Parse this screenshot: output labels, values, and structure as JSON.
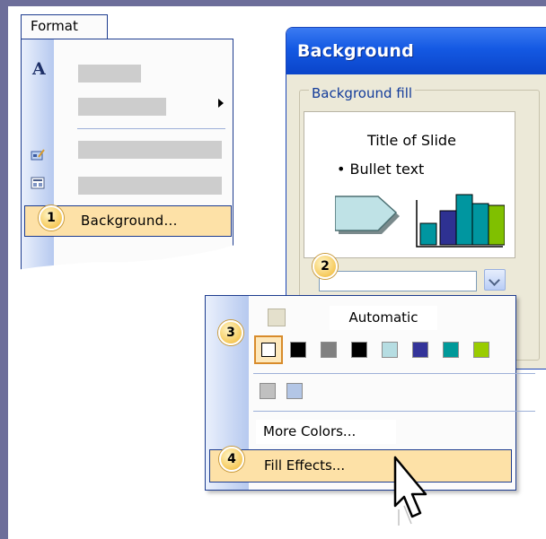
{
  "format_menu": {
    "tab_label": "Format",
    "background_item": {
      "number": "1",
      "label": "Background..."
    }
  },
  "dialog": {
    "title": "Background",
    "group_label": "Background fill",
    "preview": {
      "title": "Title of Slide",
      "bullet": "• Bullet text"
    },
    "combo_number": "2"
  },
  "color_menu": {
    "automatic_label": "Automatic",
    "palette_number": "3",
    "palette_colors": [
      "#ffffff",
      "#000000",
      "#808080",
      "#000000",
      "#b6dde2",
      "#333399",
      "#009999",
      "#99cc00"
    ],
    "recent_colors": [
      "#c0c0c0",
      "#b3c6e6"
    ],
    "more_colors_label": "More Colors...",
    "fill_effects": {
      "number": "4",
      "label": "Fill Effects..."
    }
  },
  "preview_chart_colors": [
    "#2e3192",
    "#0096a0",
    "#80c000"
  ],
  "accent_colors": {
    "highlight": "#fde1a7",
    "title_bar": "#1459e3",
    "border": "#1d3c8f"
  }
}
